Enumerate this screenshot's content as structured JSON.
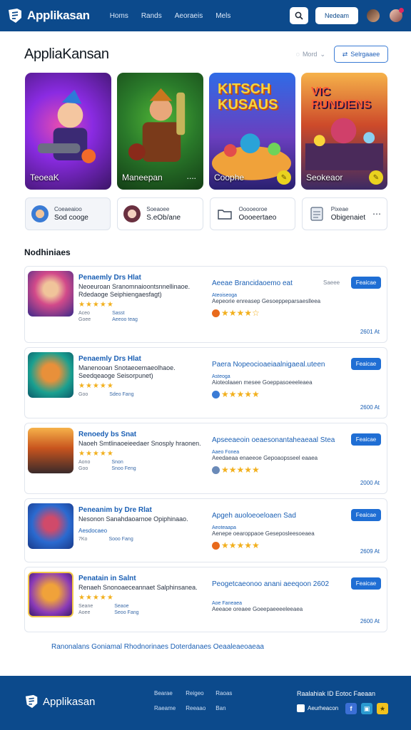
{
  "header": {
    "brand": "Applikasan",
    "nav": [
      "Homs",
      "Rands",
      "Aeoraeis",
      "Mels"
    ],
    "cta": "Nedeam"
  },
  "page": {
    "title": "AppliaKansan",
    "sort_label": "Mord",
    "action_label": "Selrgaaee"
  },
  "featured": [
    {
      "caption": "TeoeaK"
    },
    {
      "caption": "Maneepan",
      "extra": "...."
    },
    {
      "caption": "Coophe",
      "art_title": "KITSCH KUSAUS"
    },
    {
      "caption": "Seokeaor",
      "art_title": "VIC RUNDIENS"
    }
  ],
  "categories": [
    {
      "line1": "Coeaeaioo",
      "line2": "Sod cooge"
    },
    {
      "line1": "Soeaoee",
      "line2": "S.eOb/ane"
    },
    {
      "line1": "Ooooeoroe",
      "line2": "Oooeertaeo"
    },
    {
      "line1": "Pixeae",
      "line2": "Obigenaiet"
    }
  ],
  "section": {
    "title": "Nodhiniaes"
  },
  "apps": [
    {
      "title": "Penaemly Drs Hlat",
      "desc": "Neoeuroan Sranomnaioontsnnellinaoe. Rdedaoge Seiphiengaesfagt)",
      "stars": "★★★★★",
      "meta_labels": [
        "Aceo",
        "Goee"
      ],
      "meta_values": [
        "Sasst",
        "Aeeoo teag"
      ],
      "rtitle": "Aeeae Brancidaoemo eat",
      "rsub": "Ateoiseoga",
      "rbody": "Aepeorie enreasep Gesoeppeparsaeslleea",
      "side": "Saeee",
      "button": "Feaicae",
      "size": "2601 At"
    },
    {
      "title": "Penaemly Drs Hlat",
      "desc": "Manenooan Snotaeoemaeolhaoe. Seedqeaoge Seisorpunet)",
      "stars": "★★★★★",
      "meta_labels": [
        "Goo"
      ],
      "meta_values": [
        "Sdeo Fang"
      ],
      "rtitle": "Paera Nopeocioaeiaalnigaeal.uteen",
      "rsub": "Asteoga",
      "rbody": "Aioteolaaen mesee Goeppasoeeeleaea",
      "side": "",
      "button": "Feaicae",
      "size": "2600 At"
    },
    {
      "title": "Renoedy bs Snat",
      "desc": "Naoeh Smtlinaoeieedaer Snosply hraonen.",
      "stars": "★★★★★",
      "meta_labels": [
        "Aono",
        "Goo"
      ],
      "meta_values": [
        "Snon",
        "Snoo Feng"
      ],
      "rtitle": "Apseeaeoin oeaesonantaheaeaal Stea",
      "rsub": "Aaeo Fonea",
      "rbody": "Aeedaeaa enaeeoe Gepoaopsseel eaaea",
      "side": "",
      "button": "Feaicae",
      "size": "2000 At"
    },
    {
      "title": "Peneanim by Dre Rlat",
      "desc": "Nesonon Sanahdaoarnoe Opiphinaao.",
      "stars": "Aesdocaeo",
      "meta_labels": [
        "7Ko"
      ],
      "meta_values": [
        "Sooo Fang"
      ],
      "rtitle": "Apgeh auoloeoeloaen Sad",
      "rsub": "Aeoteaapa",
      "rbody": "Aenepe oearoppaoe Geseposleesoeaea",
      "side": "",
      "button": "Feaicae",
      "size": "2609 At"
    },
    {
      "title": "Penatain in Salnt",
      "desc": "Renaeh Snonoaeceannaet Salphinsanea.",
      "stars": "★★★★★",
      "meta_labels": [
        "Seane",
        "Aoee"
      ],
      "meta_values": [
        "Seaoe",
        "Seoo Fang"
      ],
      "rtitle": "Peogetcaeonoo anani aeeqoon 2602",
      "rsub": "Aoe Faneaea",
      "rbody": "Aeeaoe oreaee Goeepaeeeeleeaea",
      "side": "",
      "button": "Feaicae",
      "size": "2600 At"
    }
  ],
  "bottom_link": "Ranonalans Goniamal Rhodnorinaes Doterdanaes Oeaaleaeoaeaa",
  "footer": {
    "brand": "Applikasan",
    "links": [
      "Bearae",
      "Reigeo",
      "Raoas",
      "Raeame",
      "Reeaao",
      "Ban"
    ],
    "right_title": "Raalahiak ID Eotoc Faeaan",
    "store_label": "Aeurheacon"
  },
  "colors": {
    "primary": "#0c4a8c",
    "accent": "#1f6ed4",
    "star": "#f2b01e"
  }
}
